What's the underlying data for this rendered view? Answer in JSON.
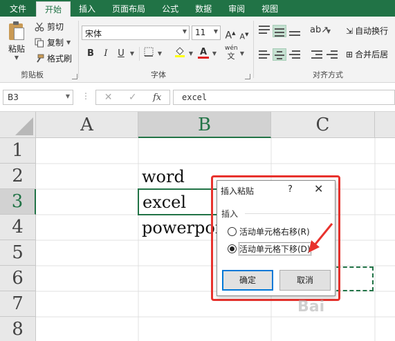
{
  "ribbon_tabs": [
    "文件",
    "开始",
    "插入",
    "页面布局",
    "公式",
    "数据",
    "审阅",
    "视图"
  ],
  "clipboard": {
    "paste_label": "粘贴",
    "cut_label": "剪切",
    "copy_label": "复制",
    "format_painter_label": "格式刷",
    "group_label": "剪贴板"
  },
  "font": {
    "font_name": "宋体",
    "font_size": "11",
    "bold": "B",
    "italic": "I",
    "underline": "U",
    "grow": "A",
    "shrink": "A",
    "font_color_letter": "A",
    "phonetic": "wén",
    "group_label": "字体"
  },
  "alignment": {
    "wrap_text_label": "自动换行",
    "merge_center_label": "合并后居",
    "group_label": "对齐方式"
  },
  "formula_bar": {
    "name_box": "B3",
    "fx": "fx",
    "content": "excel"
  },
  "sheet": {
    "columns": [
      "A",
      "B",
      "C"
    ],
    "selected_column": "B",
    "rows": [
      "1",
      "2",
      "3",
      "4",
      "5",
      "6",
      "7",
      "8"
    ],
    "selected_row": "3",
    "cells": {
      "B2": "word",
      "B3": "excel",
      "B4": "powerpoint"
    }
  },
  "dialog": {
    "title": "插入粘贴",
    "help": "?",
    "close": "✕",
    "group_label": "插入",
    "option_right": "活动单元格右移(R)",
    "option_down": "活动单元格下移(D)",
    "selected_option": "down",
    "ok_label": "确定",
    "cancel_label": "取消"
  },
  "watermark": "Bai"
}
